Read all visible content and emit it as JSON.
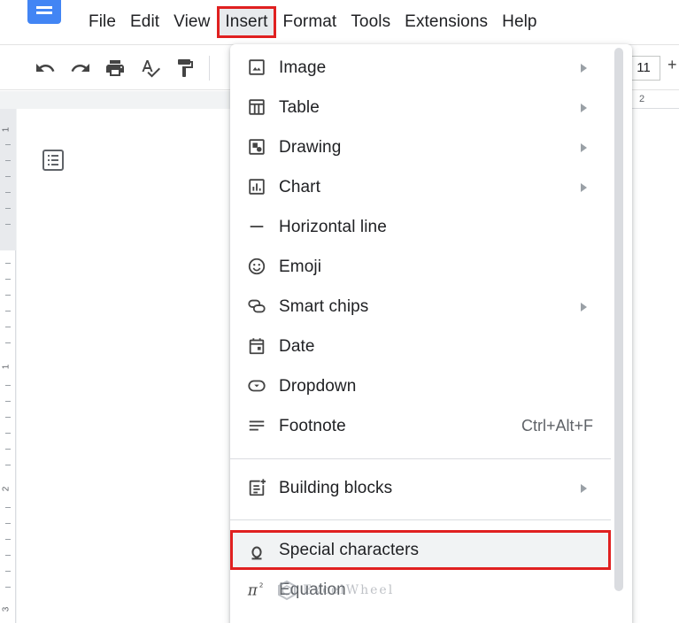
{
  "app": {
    "menus": [
      {
        "label": "File"
      },
      {
        "label": "Edit"
      },
      {
        "label": "View"
      },
      {
        "label": "Insert",
        "active": true
      },
      {
        "label": "Format"
      },
      {
        "label": "Tools"
      },
      {
        "label": "Extensions"
      },
      {
        "label": "Help"
      }
    ]
  },
  "toolbar": {
    "icons": [
      "undo-icon",
      "redo-icon",
      "print-icon",
      "spellcheck-icon",
      "paint-format-icon"
    ],
    "font_size": "11",
    "plus_label": "+"
  },
  "ruler": {
    "horizontal_number": "2",
    "vertical_numbers": [
      "1",
      "1",
      "2",
      "3"
    ]
  },
  "insert_menu": {
    "items": [
      {
        "label": "Image",
        "icon": "image-icon",
        "submenu": true
      },
      {
        "label": "Table",
        "icon": "table-icon",
        "submenu": true
      },
      {
        "label": "Drawing",
        "icon": "drawing-icon",
        "submenu": true
      },
      {
        "label": "Chart",
        "icon": "chart-icon",
        "submenu": true
      },
      {
        "label": "Horizontal line",
        "icon": "horizontal-line-icon",
        "submenu": false
      },
      {
        "label": "Emoji",
        "icon": "emoji-icon",
        "submenu": false
      },
      {
        "label": "Smart chips",
        "icon": "smart-chips-icon",
        "submenu": true
      },
      {
        "label": "Date",
        "icon": "date-icon",
        "submenu": false
      },
      {
        "label": "Dropdown",
        "icon": "dropdown-icon",
        "submenu": false
      },
      {
        "label": "Footnote",
        "icon": "footnote-icon",
        "shortcut": "Ctrl+Alt+F"
      },
      {
        "label": "Building blocks",
        "icon": "building-blocks-icon",
        "submenu": true
      },
      {
        "label": "Special characters",
        "icon": "omega-icon",
        "highlighted": true
      },
      {
        "label": "Equation",
        "icon": "pi-icon"
      }
    ]
  },
  "watermark": {
    "text": "ExcelWheel"
  },
  "colors": {
    "highlight_border": "#e02020",
    "brand_blue": "#4285f4",
    "menu_text": "#202124"
  }
}
